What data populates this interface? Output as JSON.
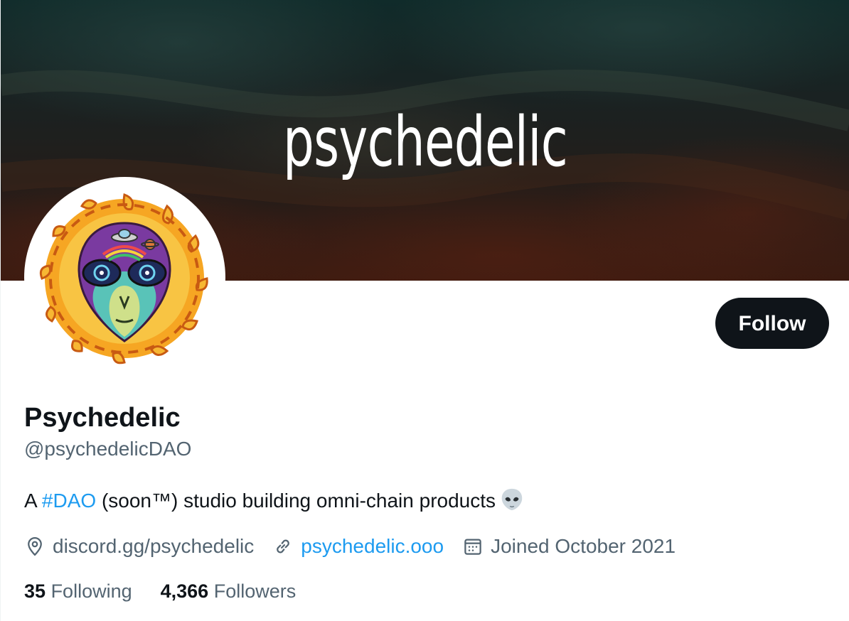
{
  "banner": {
    "title": "psychedelic"
  },
  "profile": {
    "display_name": "Psychedelic",
    "handle": "@psychedelicDAO",
    "bio": {
      "prefix": "A ",
      "hashtag": "#DAO",
      "suffix": " (soon™) studio building omni-chain products"
    },
    "location": "discord.gg/psychedelic",
    "website": "psychedelic.ooo",
    "joined": "Joined October 2021"
  },
  "actions": {
    "follow_label": "Follow"
  },
  "stats": {
    "following_count": "35",
    "following_label": "Following",
    "followers_count": "4,366",
    "followers_label": "Followers"
  },
  "colors": {
    "accent": "#1d9bf0",
    "text_primary": "#0f1419",
    "text_secondary": "#536471",
    "button_bg": "#0f1419"
  },
  "icons": {
    "location": "location-pin-icon",
    "website": "link-icon",
    "joined": "calendar-icon",
    "emoji": "alien-emoji-icon"
  }
}
